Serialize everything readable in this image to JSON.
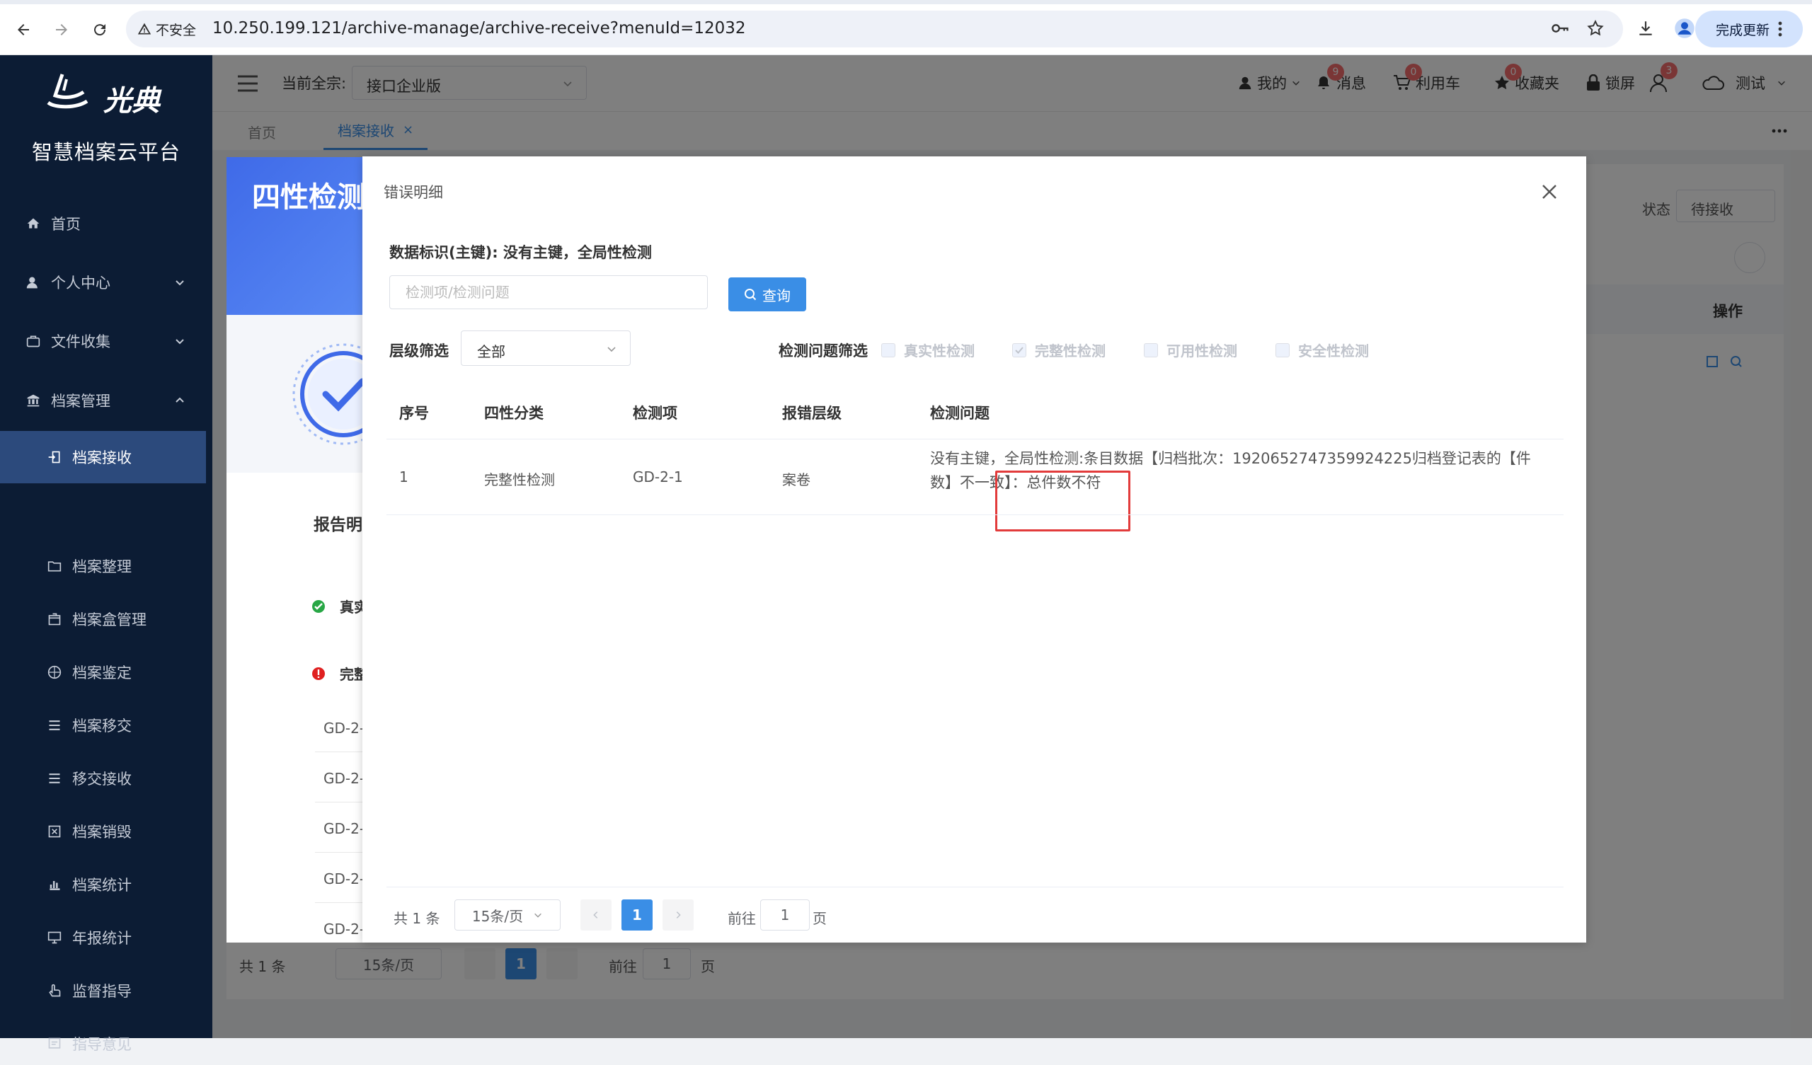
{
  "browser": {
    "insecure_label": "不安全",
    "url": "10.250.199.121/archive-manage/archive-receive?menuId=12032",
    "update_label": "完成更新"
  },
  "sidebar": {
    "platform_name": "智慧档案云平台",
    "logo_text": "光典",
    "items": [
      {
        "label": "首页",
        "icon": "home-icon"
      },
      {
        "label": "个人中心",
        "icon": "user-icon"
      },
      {
        "label": "文件收集",
        "icon": "briefcase-icon"
      },
      {
        "label": "档案管理",
        "icon": "bank-icon"
      }
    ],
    "sub_items": [
      {
        "label": "档案接收",
        "icon": "import-icon"
      },
      {
        "label": "档案整理",
        "icon": "folder-icon"
      },
      {
        "label": "档案盒管理",
        "icon": "box-icon"
      },
      {
        "label": "档案鉴定",
        "icon": "compass-icon"
      },
      {
        "label": "档案移交",
        "icon": "list-icon"
      },
      {
        "label": "移交接收",
        "icon": "list-icon"
      },
      {
        "label": "档案销毁",
        "icon": "destroy-icon"
      },
      {
        "label": "档案统计",
        "icon": "bar-chart-icon"
      },
      {
        "label": "年报统计",
        "icon": "monitor-icon"
      },
      {
        "label": "监督指导",
        "icon": "hand-icon"
      },
      {
        "label": "指导意见",
        "icon": "comment-icon"
      }
    ]
  },
  "header": {
    "current_label": "当前全宗:",
    "company": "接口企业版",
    "mine": "我的",
    "messages": "消息",
    "messages_count": "9",
    "cart": "利用车",
    "cart_count": "0",
    "favorites": "收藏夹",
    "favorites_count": "0",
    "lock": "锁屏",
    "users_count": "3",
    "test": "测试"
  },
  "tabs": [
    {
      "label": "首页"
    },
    {
      "label": "档案接收"
    }
  ],
  "background": {
    "status_label": "状态",
    "status_value": "待接收",
    "ops_header": "操作",
    "total": "共 1 条",
    "page_size": "15条/页",
    "current_page": "1",
    "goto": "前往",
    "goto_value": "1",
    "page_unit": "页"
  },
  "report": {
    "title": "四性检测",
    "section": "报告明",
    "rows": [
      "真实",
      "完整"
    ],
    "items": [
      "GD-2-",
      "GD-2-",
      "GD-2-",
      "GD-2-",
      "GD-2-"
    ]
  },
  "modal": {
    "title": "错误明细",
    "data_id": "数据标识(主键): 没有主键，全局性检测",
    "search_placeholder": "检测项/检测问题",
    "query_label": "查询",
    "level_label": "层级筛选",
    "level_value": "全部",
    "issue_filter_label": "检测问题筛选",
    "checks": [
      {
        "label": "真实性检测",
        "checked": false
      },
      {
        "label": "完整性检测",
        "checked": true
      },
      {
        "label": "可用性检测",
        "checked": false
      },
      {
        "label": "安全性检测",
        "checked": false
      }
    ],
    "columns": [
      "序号",
      "四性分类",
      "检测项",
      "报错层级",
      "检测问题"
    ],
    "rows": [
      {
        "no": "1",
        "category": "完整性检测",
        "item": "GD-2-1",
        "level": "案卷",
        "issue": "没有主键，全局性检测:条目数据【归档批次：1920652747359924225归档登记表的【件数】不一致】：总件数不符"
      }
    ],
    "pagination": {
      "total": "共 1 条",
      "page_size": "15条/页",
      "current_page": "1",
      "goto": "前往",
      "goto_value": "1",
      "page_unit": "页"
    }
  },
  "colors": {
    "sidebar_bg": "#0c1c34",
    "sidebar_active": "#2c4a7c",
    "primary": "#3a8ee6",
    "highlight": "#e23b3b",
    "badge": "#f56c6c"
  }
}
